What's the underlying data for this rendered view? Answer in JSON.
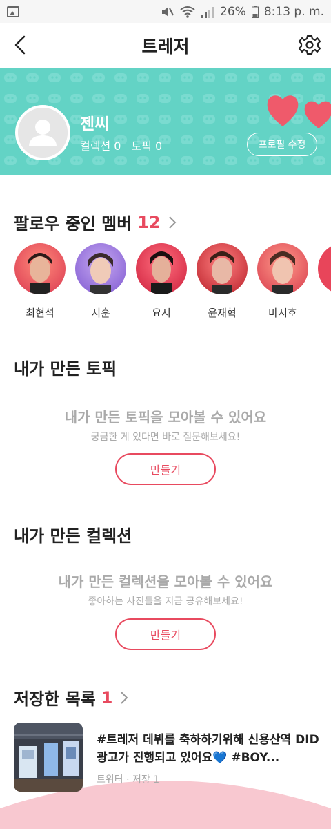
{
  "status_bar": {
    "battery": "26%",
    "time": "8:13 p. m."
  },
  "header": {
    "title": "트레저"
  },
  "profile": {
    "name": "젠씨",
    "collection_stat": "컬렉션 0",
    "topic_stat": "토픽 0",
    "edit_label": "프로필 수정"
  },
  "following": {
    "title": "팔로우 중인 멤버",
    "count": "12",
    "members": [
      {
        "name": "최현석"
      },
      {
        "name": "지훈"
      },
      {
        "name": "요시"
      },
      {
        "name": "윤재혁"
      },
      {
        "name": "마시호"
      }
    ]
  },
  "my_topics": {
    "title": "내가 만든 토픽",
    "empty_title": "내가 만든 토픽을 모아볼 수 있어요",
    "empty_sub": "궁금한 게 있다면 바로 질문해보세요!",
    "button": "만들기"
  },
  "my_collections": {
    "title": "내가 만든 컬렉션",
    "empty_title": "내가 만든 컬렉션을 모아볼 수 있어요",
    "empty_sub": "좋아하는 사진들을 지금 공유해보세요!",
    "button": "만들기"
  },
  "saved": {
    "title": "저장한 목록",
    "count": "1",
    "items": [
      {
        "text": "#트레저 데뷔를 축하하기위해 신용산역 DID 광고가 진행되고 있어요💙 #BOY...",
        "meta": "트위터 · 저장 1"
      }
    ]
  },
  "colors": {
    "accent": "#e84a5f",
    "banner": "#63d3c5",
    "muted": "#aaaaaa"
  }
}
